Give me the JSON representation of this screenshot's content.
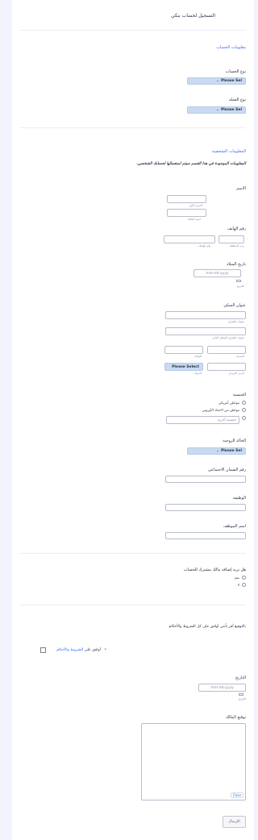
{
  "title": "التسجيل لحساب بنكي",
  "account_section": {
    "heading": "معلومات الحساب",
    "account_type_label": "نوع الحساب",
    "currency_label": "نوع العملة",
    "select_placeholder": "Please Sel"
  },
  "personal_section": {
    "heading": "المعلومات الشخصية",
    "note": "المعلومات الموجودة في هذا القسم سيتم استعمالها لحسابك الشخصي.",
    "name_label": "الاسم",
    "first_name_sub": "الاسم الأول",
    "last_name_sub": "اسم العائلة",
    "phone_label": "رقم الهاتف",
    "area_code_sub": "رمز المنطقة",
    "phone_number_sub": "رقم الهاتف",
    "dob_label": "تاريخ الميلاد",
    "date_placeholder": "mm-dd-yyyy",
    "date_sub": "التاريخ",
    "address_label": "عنوان السكن",
    "street_sub": "عنوان الشارع",
    "street2_sub": "عنوان الشارع السطر الثاني",
    "city_sub": "المدينة",
    "state_sub": "الولاية",
    "postal_sub": "الرمز البريدي",
    "country_sub": "الدولة",
    "country_select": "Please Select",
    "nationality_label": "الجنسية",
    "nationality_options": [
      "مواطن أمريكي",
      "مواطن من الاتحاد الأوروبي"
    ],
    "other_nationality_placeholder": "جنسية أخرى",
    "marital_label": "الحالة الزوجية",
    "marital_select": "Please Sel",
    "ssn_label": "رقم الضمان الاجتماعي",
    "job_label": "الوظيفة",
    "employer_label": "اسم الموظف"
  },
  "joint_section": {
    "question": "هل تريد إضافة مالك مشترك للحساب",
    "options": [
      "نعم",
      "لا"
    ]
  },
  "terms_section": {
    "statement": "بالتوقيع أقر بأنني أوافق على كل الشروط والأحكام",
    "agree_prefix": "أوافق على",
    "agree_link": "الشروط والأحكام",
    "required_star": "*",
    "date_label": "التاريخ",
    "date_placeholder": "mm-dd-yyyy",
    "date_sub": "التاريخ",
    "signature_label": "توقيع المالك",
    "clear_label": "Clear",
    "submit_label": "الإرسال"
  },
  "colors": {
    "accent": "#2e69ff",
    "select_bg": "#c8dbf3",
    "page_bg": "#f3f3fe"
  }
}
